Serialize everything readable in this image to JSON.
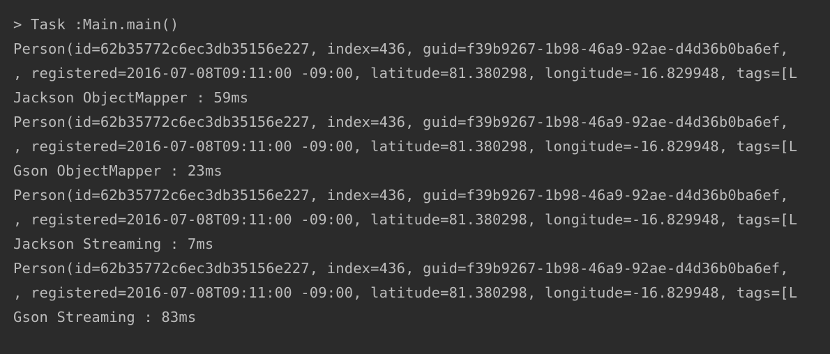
{
  "console": {
    "lines": [
      "> Task :Main.main()",
      "Person(id=62b35772c6ec3db35156e227, index=436, guid=f39b9267-1b98-46a9-92ae-d4d36b0ba6ef,",
      ", registered=2016-07-08T09:11:00 -09:00, latitude=81.380298, longitude=-16.829948, tags=[L",
      "Jackson ObjectMapper : 59ms",
      "Person(id=62b35772c6ec3db35156e227, index=436, guid=f39b9267-1b98-46a9-92ae-d4d36b0ba6ef,",
      ", registered=2016-07-08T09:11:00 -09:00, latitude=81.380298, longitude=-16.829948, tags=[L",
      "Gson ObjectMapper : 23ms",
      "Person(id=62b35772c6ec3db35156e227, index=436, guid=f39b9267-1b98-46a9-92ae-d4d36b0ba6ef,",
      ", registered=2016-07-08T09:11:00 -09:00, latitude=81.380298, longitude=-16.829948, tags=[L",
      "Jackson Streaming : 7ms",
      "Person(id=62b35772c6ec3db35156e227, index=436, guid=f39b9267-1b98-46a9-92ae-d4d36b0ba6ef,",
      ", registered=2016-07-08T09:11:00 -09:00, latitude=81.380298, longitude=-16.829948, tags=[L",
      "Gson Streaming : 83ms"
    ]
  },
  "colors": {
    "background": "#2b2b2b",
    "text": "#bbbbbb"
  }
}
